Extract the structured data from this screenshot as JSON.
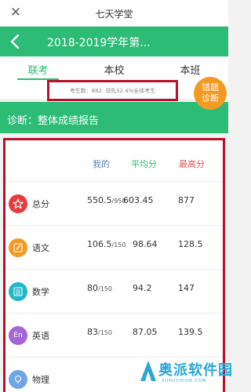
{
  "window": {
    "title": "七天学堂"
  },
  "header": {
    "title": "2018-2019学年第..."
  },
  "tabs": [
    {
      "label": "联考",
      "active": true
    },
    {
      "label": "本校",
      "active": false
    },
    {
      "label": "本班",
      "active": false
    }
  ],
  "stats": {
    "examinees_label": "考生数：882",
    "lead_label": "领先32.4%全体考生"
  },
  "badge": {
    "line1": "错题",
    "line2": "诊断"
  },
  "diagnosis": {
    "title": "诊断：整体成绩报告"
  },
  "table": {
    "columns": {
      "mine": "我的",
      "average": "平均分",
      "max": "最高分"
    },
    "rows": [
      {
        "subject": "总分",
        "icon": "star-icon",
        "mine": "550.5",
        "full": "/950",
        "average": "603.45",
        "max": "877",
        "color": "#e53d3d"
      },
      {
        "subject": "语文",
        "icon": "pencil-icon",
        "mine": "106.5",
        "full": "/150",
        "average": "98.64",
        "max": "128.5",
        "color": "#f39a26"
      },
      {
        "subject": "数学",
        "icon": "calculator-icon",
        "mine": "80",
        "full": "/150",
        "average": "94.2",
        "max": "147",
        "color": "#1fb9c9"
      },
      {
        "subject": "英语",
        "icon": "english-icon",
        "mine": "83",
        "full": "/150",
        "average": "87.05",
        "max": "139.5",
        "color": "#a465d6"
      },
      {
        "subject": "物理",
        "icon": "bulb-icon",
        "mine": "",
        "full": "",
        "average": "",
        "max": "",
        "color": "#6fa6e8"
      }
    ]
  },
  "watermark": {
    "text": "奥派软件园",
    "sub": "XUHUCHION.COM"
  },
  "colors": {
    "green": "#2dbc76",
    "orange": "#f39a26",
    "highlight_red": "#b7112b",
    "mine_header": "#5a7db5",
    "average_header": "#2dbc76",
    "max_header": "#e05555"
  }
}
